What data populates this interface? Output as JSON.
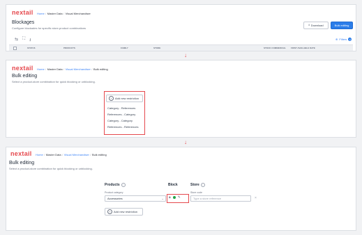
{
  "brand": {
    "logo": "nextail",
    "accent": "#e5484d",
    "primary": "#2b7de9"
  },
  "breadcrumb_step1": [
    "Home",
    "Master Data",
    "Visual Merchandiser"
  ],
  "breadcrumb_step2": [
    "Home",
    "Master Data",
    "Visual Merchandiser",
    "Bulk editing"
  ],
  "step1": {
    "title": "Blockages",
    "subtitle": "Configure blockades for specific store-product combinations",
    "download_label": "Download",
    "bulk_editing_label": "Bulk editing",
    "filters_label": "Filters",
    "filters_count": "3",
    "columns": [
      "STATUS",
      "PRODUCTS",
      "FAMILY",
      "STORE",
      "STOCK COMMERCIAL",
      "FIRST AVAILABLE DATE"
    ]
  },
  "step2": {
    "title": "Bulk editing",
    "subtitle": "Select a product-store combination for quick blocking or unblocking.",
    "add_restriction_label": "Add new restriction",
    "menu_items": [
      "Category - References",
      "References - Category",
      "Category - Category",
      "References - References"
    ]
  },
  "step3": {
    "title": "Bulk editing",
    "subtitle": "Select a product-store combination for quick blocking or unblocking.",
    "products_header": "Products",
    "block_header": "Block",
    "store_header": "Store",
    "product_category_label": "Product category",
    "product_category_value": "Accessories",
    "store_code_label": "Store code",
    "store_placeholder": "Type a store reference",
    "add_restriction_label": "Add new restriction"
  },
  "icons": [
    "download-icon",
    "plus-circle-icon",
    "info-icon",
    "lock-icon",
    "edit-icon",
    "chevron-down-icon",
    "close-icon",
    "arrow-down-icon"
  ]
}
